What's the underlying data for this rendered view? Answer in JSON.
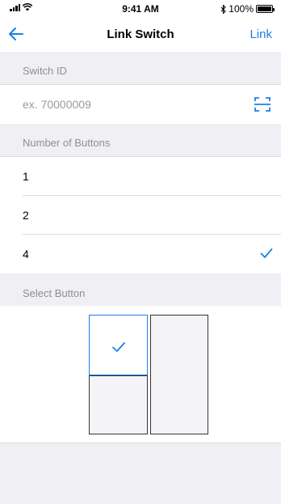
{
  "status": {
    "time": "9:41 AM",
    "battery": "100%",
    "battery_level": 1.0
  },
  "nav": {
    "title": "Link Switch",
    "action": "Link",
    "back_icon": "arrow-left-icon"
  },
  "switch_id": {
    "header": "Switch ID",
    "placeholder": "ex. 70000009",
    "scan_icon": "scan-frame-icon"
  },
  "buttons_count": {
    "header": "Number of Buttons",
    "options": [
      "1",
      "2",
      "4"
    ],
    "selected": "4"
  },
  "select_button": {
    "header": "Select Button"
  },
  "colors": {
    "accent": "#1b7fe6",
    "background": "#efeff4",
    "secondary_text": "#8e8e93"
  }
}
